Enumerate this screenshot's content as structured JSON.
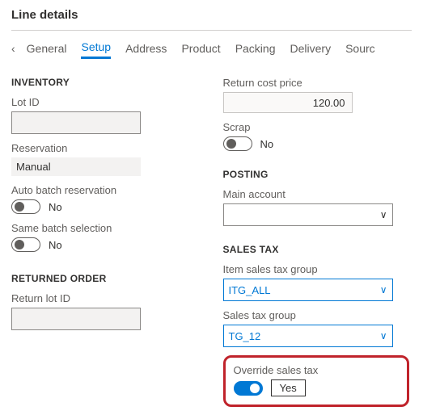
{
  "title": "Line details",
  "tabs": {
    "items": [
      "General",
      "Setup",
      "Address",
      "Product",
      "Packing",
      "Delivery",
      "Sourc"
    ],
    "active_index": 1
  },
  "inventory": {
    "heading": "INVENTORY",
    "lot_id_label": "Lot ID",
    "lot_id_value": "",
    "reservation_label": "Reservation",
    "reservation_value": "Manual",
    "auto_batch_label": "Auto batch reservation",
    "auto_batch_value": "No",
    "same_batch_label": "Same batch selection",
    "same_batch_value": "No"
  },
  "returned_order": {
    "heading": "RETURNED ORDER",
    "return_lot_label": "Return lot ID",
    "return_lot_value": ""
  },
  "right": {
    "return_cost_label": "Return cost price",
    "return_cost_value": "120.00",
    "scrap_label": "Scrap",
    "scrap_value": "No"
  },
  "posting": {
    "heading": "POSTING",
    "main_account_label": "Main account",
    "main_account_value": ""
  },
  "sales_tax": {
    "heading": "SALES TAX",
    "item_group_label": "Item sales tax group",
    "item_group_value": "ITG_ALL",
    "group_label": "Sales tax group",
    "group_value": "TG_12",
    "override_label": "Override sales tax",
    "override_value": "Yes"
  }
}
